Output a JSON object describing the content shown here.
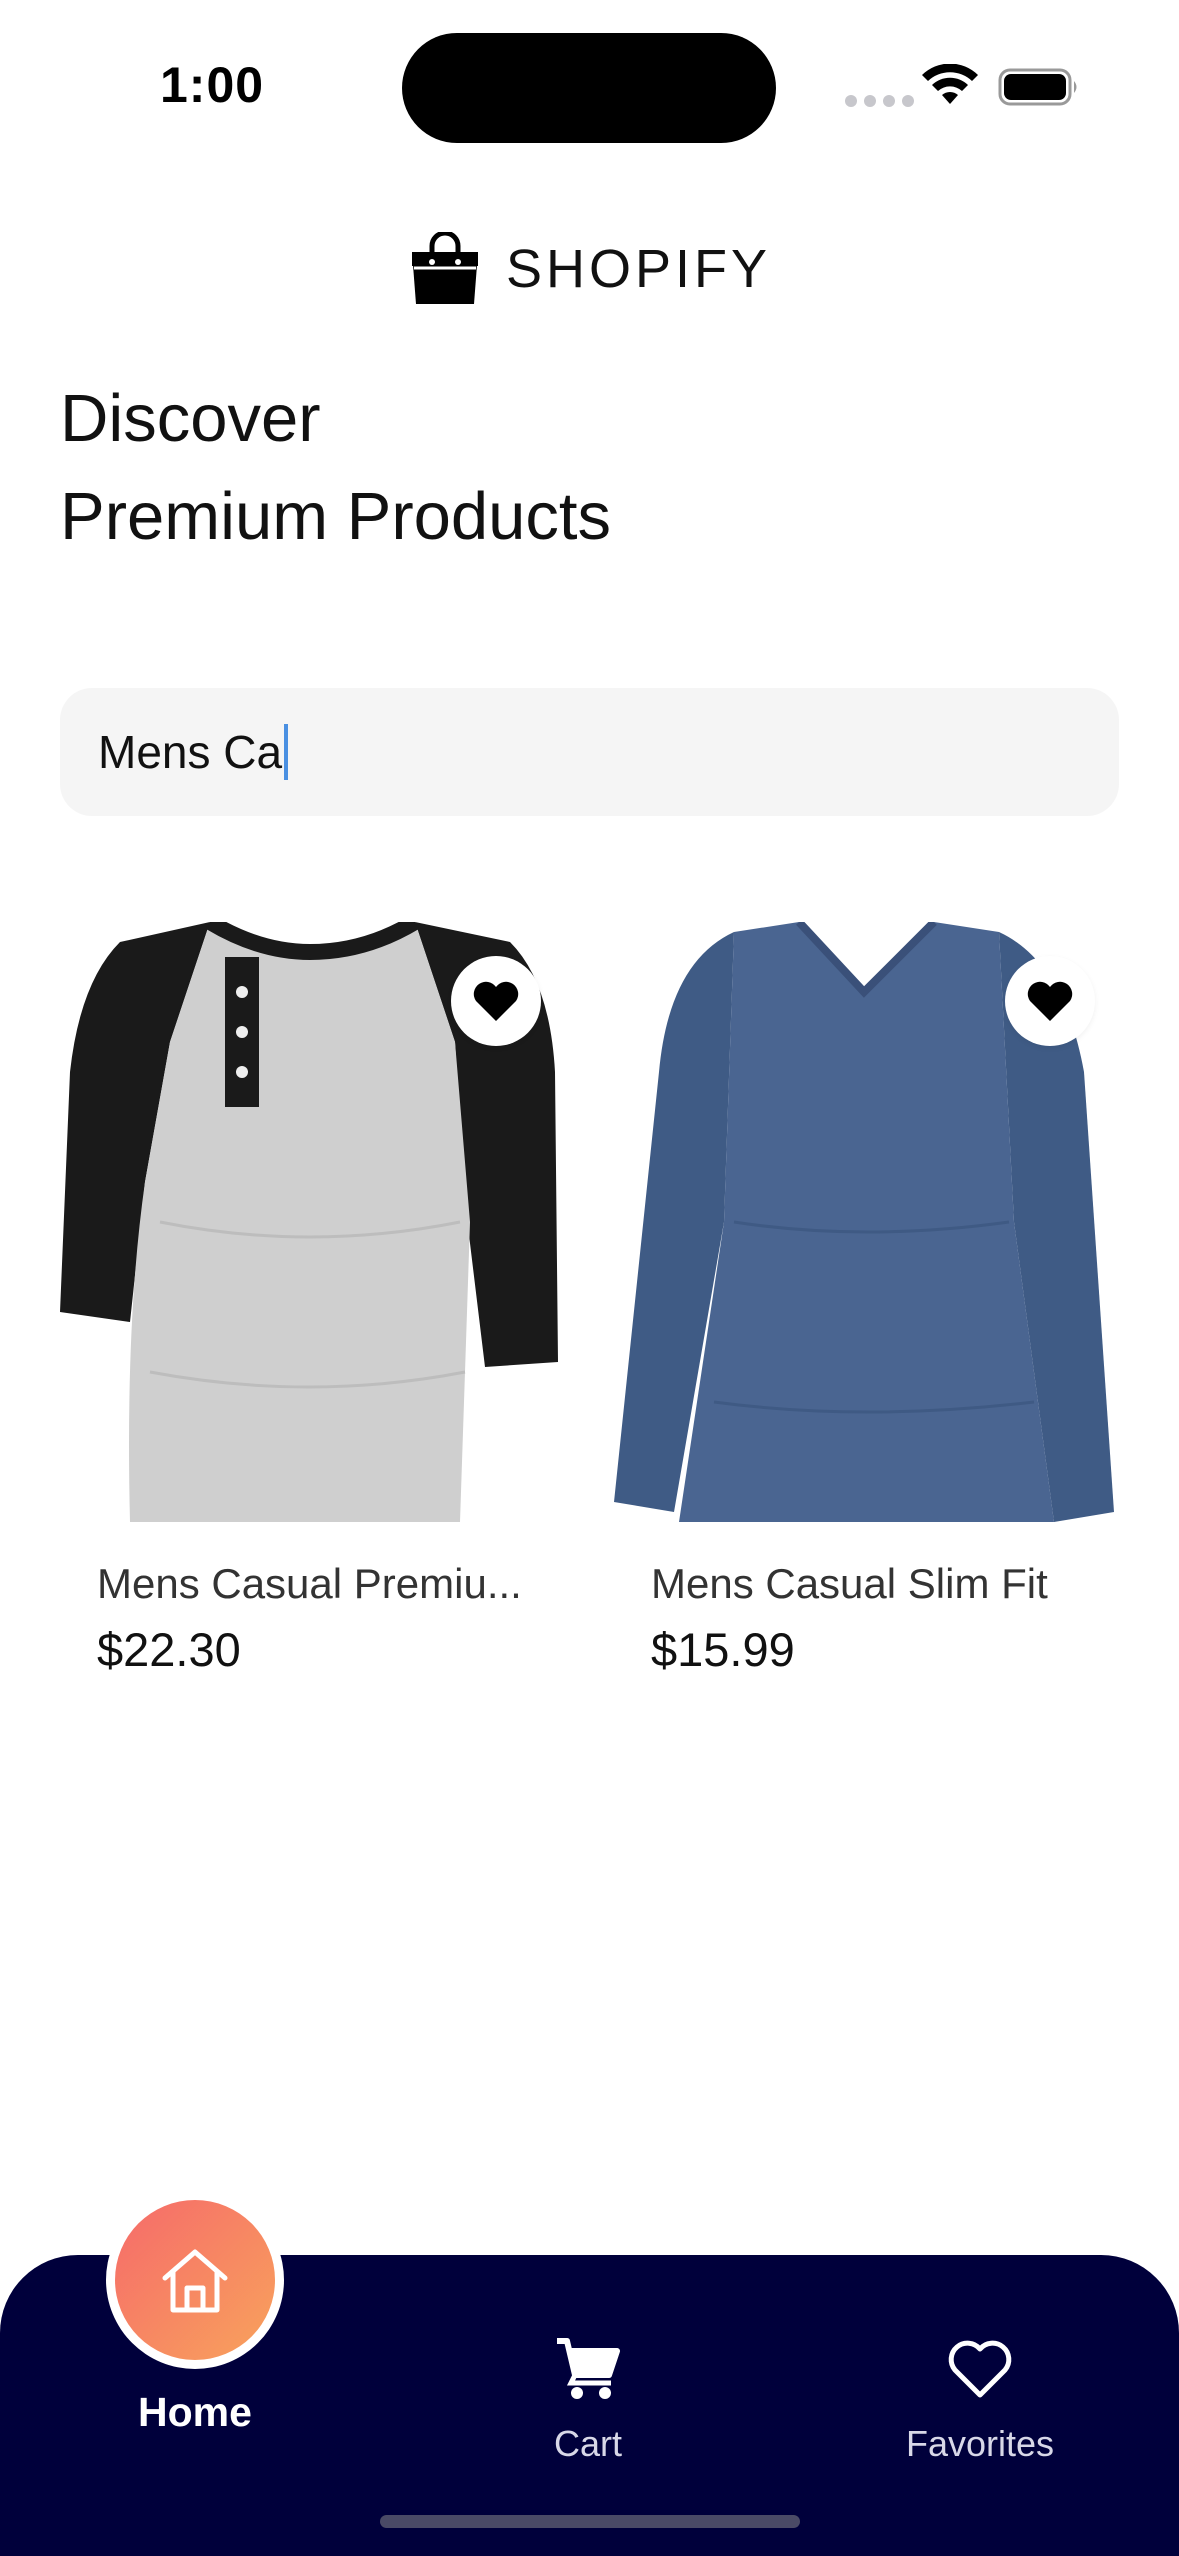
{
  "status_bar": {
    "time": "1:00",
    "icons": [
      "signal-dots-icon",
      "wifi-icon",
      "battery-icon"
    ]
  },
  "brand": {
    "name": "SHOPIFY",
    "logo_icon": "shopping-bag-icon"
  },
  "heading": {
    "line1": "Discover",
    "line2": "Premium Products"
  },
  "search": {
    "value": "Mens Ca"
  },
  "products": [
    {
      "name": "Mens Casual Premiu...",
      "price": "$22.30",
      "favorite_icon": "heart-icon"
    },
    {
      "name": "Mens Casual Slim Fit",
      "price": "$15.99",
      "favorite_icon": "heart-icon"
    }
  ],
  "tabbar": {
    "tabs": [
      {
        "label": "Home",
        "icon": "home-icon",
        "active": true
      },
      {
        "label": "Cart",
        "icon": "cart-icon",
        "active": false
      },
      {
        "label": "Favorites",
        "icon": "heart-outline-icon",
        "active": false
      }
    ]
  },
  "colors": {
    "tabbar_bg": "#00003b",
    "home_gradient_start": "#f66a6a",
    "home_gradient_end": "#f8a35c",
    "search_bg": "#f5f5f5",
    "caret": "#4a90e2"
  }
}
